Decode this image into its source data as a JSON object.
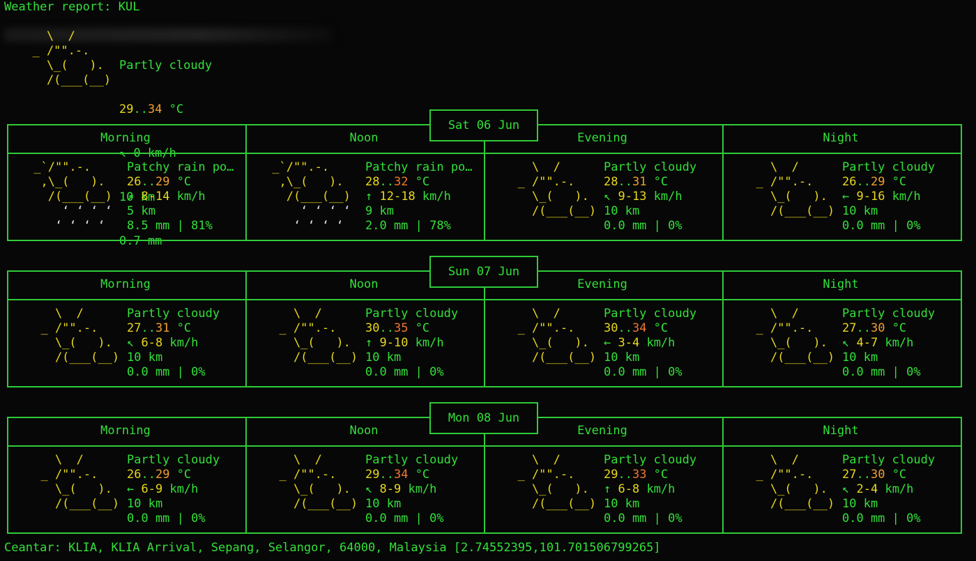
{
  "header": {
    "title": "Weather report: KUL"
  },
  "current": {
    "icon": "sun-cloud-icon",
    "condition": "Partly cloudy",
    "temp_low": "29",
    "temp_sep": "..",
    "temp_high": "34",
    "temp_unit": " °C",
    "wind": "↖ 0 km/h",
    "visibility": "10 km",
    "precip": "0.7 mm"
  },
  "days": [
    {
      "date": "Sat 06 Jun",
      "periods": [
        {
          "label": "Morning",
          "condition": "Patchy rain po…",
          "temp_low": "26",
          "temp_high": "29",
          "wind_arrow": "↗",
          "wind": "8-14",
          "visibility": "5 km",
          "precip": "8.5 mm | 81%",
          "icon": "rain-cloud-icon"
        },
        {
          "label": "Noon",
          "condition": "Patchy rain po…",
          "temp_low": "28",
          "temp_high": "32",
          "wind_arrow": "↑",
          "wind": "12-18",
          "visibility": "9 km",
          "precip": "2.0 mm | 78%",
          "icon": "rain-cloud-icon"
        },
        {
          "label": "Evening",
          "condition": "Partly cloudy",
          "temp_low": "28",
          "temp_high": "31",
          "wind_arrow": "↖",
          "wind": "9-13",
          "visibility": "10 km",
          "precip": "0.0 mm | 0%",
          "icon": "sun-cloud-icon"
        },
        {
          "label": "Night",
          "condition": "Partly cloudy",
          "temp_low": "26",
          "temp_high": "29",
          "wind_arrow": "←",
          "wind": "9-16",
          "visibility": "10 km",
          "precip": "0.0 mm | 0%",
          "icon": "sun-cloud-icon"
        }
      ]
    },
    {
      "date": "Sun 07 Jun",
      "periods": [
        {
          "label": "Morning",
          "condition": "Partly cloudy",
          "temp_low": "27",
          "temp_high": "31",
          "wind_arrow": "↖",
          "wind": "6-8",
          "visibility": "10 km",
          "precip": "0.0 mm | 0%",
          "icon": "sun-cloud-icon"
        },
        {
          "label": "Noon",
          "condition": "Partly cloudy",
          "temp_low": "30",
          "temp_high": "35",
          "wind_arrow": "↑",
          "wind": "9-10",
          "visibility": "10 km",
          "precip": "0.0 mm | 0%",
          "icon": "sun-cloud-icon"
        },
        {
          "label": "Evening",
          "condition": "Partly cloudy",
          "temp_low": "30",
          "temp_high": "34",
          "wind_arrow": "←",
          "wind": "3-4",
          "visibility": "10 km",
          "precip": "0.0 mm | 0%",
          "icon": "sun-cloud-icon"
        },
        {
          "label": "Night",
          "condition": "Partly cloudy",
          "temp_low": "27",
          "temp_high": "30",
          "wind_arrow": "↖",
          "wind": "4-7",
          "visibility": "10 km",
          "precip": "0.0 mm | 0%",
          "icon": "sun-cloud-icon"
        }
      ]
    },
    {
      "date": "Mon 08 Jun",
      "periods": [
        {
          "label": "Morning",
          "condition": "Partly cloudy",
          "temp_low": "26",
          "temp_high": "29",
          "wind_arrow": "←",
          "wind": "6-9",
          "visibility": "10 km",
          "precip": "0.0 mm | 0%",
          "icon": "sun-cloud-icon"
        },
        {
          "label": "Noon",
          "condition": "Partly cloudy",
          "temp_low": "29",
          "temp_high": "34",
          "wind_arrow": "↖",
          "wind": "8-9",
          "visibility": "10 km",
          "precip": "0.0 mm | 0%",
          "icon": "sun-cloud-icon"
        },
        {
          "label": "Evening",
          "condition": "Partly cloudy",
          "temp_low": "29",
          "temp_high": "33",
          "wind_arrow": "↑",
          "wind": "6-8",
          "visibility": "10 km",
          "precip": "0.0 mm | 0%",
          "icon": "sun-cloud-icon"
        },
        {
          "label": "Night",
          "condition": "Partly cloudy",
          "temp_low": "27",
          "temp_high": "30",
          "wind_arrow": "↖",
          "wind": "2-4",
          "visibility": "10 km",
          "precip": "0.0 mm | 0%",
          "icon": "sun-cloud-icon"
        }
      ]
    }
  ],
  "units": {
    "temp": " °C",
    "wind": " km/h",
    "temp_sep": ".."
  },
  "footer": {
    "location": "Ceantar: KLIA, KLIA Arrival, Sepang, Selangor, 64000, Malaysia [2.74552395,101.701506799265]"
  },
  "colors": {
    "text": "#33e03a",
    "icon_sun": "#e8d81e",
    "rain": "#d7dde6",
    "temp_warm": "#f0a030",
    "temp_hot": "#f07830",
    "background": "#070707"
  }
}
